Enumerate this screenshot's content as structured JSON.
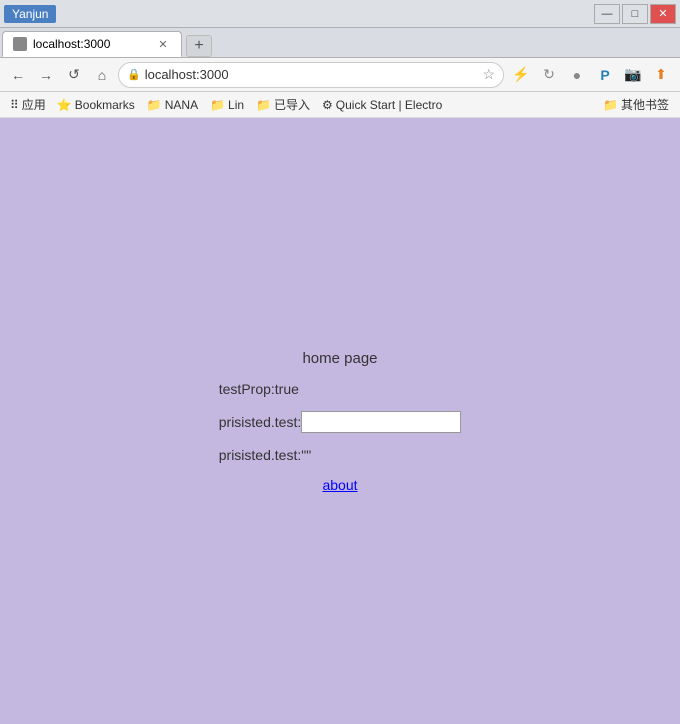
{
  "window": {
    "user_tag": "Yanjun",
    "minimize_label": "—",
    "maximize_label": "□",
    "close_label": "✕"
  },
  "tab": {
    "title": "localhost:3000",
    "url": "localhost:3000",
    "new_tab_label": "+"
  },
  "nav": {
    "back_label": "←",
    "forward_label": "→",
    "reload_label": "↺",
    "home_label": "⌂",
    "address": "localhost:3000",
    "star_label": "☆"
  },
  "bookmarks": {
    "apps_label": "应用",
    "bookmarks_label": "Bookmarks",
    "nana_label": "NANA",
    "lin_label": "Lin",
    "import_label": "已导入",
    "quickstart_label": "Quick Start | Electro",
    "more_label": "其他书签"
  },
  "page": {
    "title": "home page",
    "test_prop_label": "testProp:true",
    "persisted_test_label": "prisisted.test:",
    "persisted_test_empty_label": "prisisted.test:\"\"",
    "input_value": "",
    "about_link": "about"
  }
}
